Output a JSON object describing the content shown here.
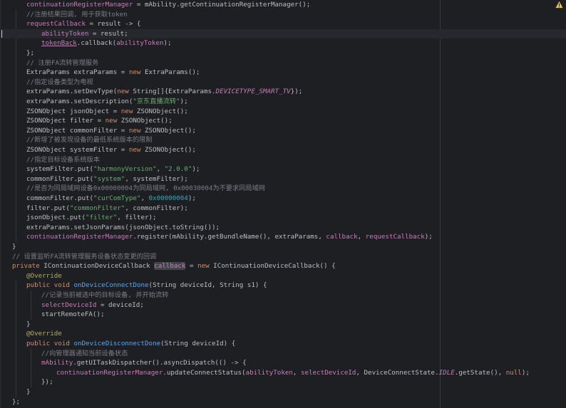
{
  "editor": {
    "hint": "requestCallback:",
    "lines": [
      "continuationRegisterManager = mAbility.getContinuationRegisterManager();",
      "//注册结果回调, 用于获取token",
      "requestCallback = result -> {",
      "abilityToken = result;",
      "tokenBack.callback(abilityToken);",
      "};",
      "// 注册FA流转管理服务",
      "ExtraParams extraParams = new ExtraParams();",
      "//指定设备类型为电视",
      "extraParams.setDevType(new String[]{ExtraParams.DEVICETYPE_SMART_TV});",
      "extraParams.setDescription(\"京东直播流转\");",
      "ZSONObject jsonObject = new ZSONObject();",
      "ZSONObject filter = new ZSONObject();",
      "ZSONObject commonFilter = new ZSONObject();",
      "//新增了被发现设备的最低系统版本的限制",
      "ZSONObject systemFilter = new ZSONObject();",
      "//指定目标设备系统版本",
      "systemFilter.put(\"harmonyVersion\", \"2.0.0\");",
      "commonFilter.put(\"system\", systemFilter);",
      "//是否为同局域网设备0x00000004为同局域网, 0x00030004为不要求同局域网",
      "commonFilter.put(\"curComType\", 0x00000004);",
      "filter.put(\"commonFilter\", commonFilter);",
      "jsonObject.put(\"filter\", filter);",
      "extraParams.setJsonParams(jsonObject.toString());",
      "continuationRegisterManager.register(mAbility.getBundleName(), extraParams, callback, requestCallback);",
      "}",
      "// 设置监听FA流转管理服务设备状态变更的回调",
      "private IContinuationDeviceCallback callback = new IContinuationDeviceCallback() {",
      "@Override",
      "public void onDeviceConnectDone(String deviceId, String s1) {",
      "//记录当前被选中的目标设备, 并开始流转",
      "selectDeviceId = deviceId;",
      "startRemoteFA();",
      "}",
      "@Override",
      "public void onDeviceDisconnectDone(String deviceId) {",
      "//向管理器通知当前设备状态",
      "mAbility.getUITaskDispatcher().asyncDispatch(() -> {",
      "continuationRegisterManager.updateConnectStatus(abilityToken, selectDeviceId, DeviceConnectState.IDLE.getState(), null);",
      "});",
      "}",
      "};"
    ]
  }
}
